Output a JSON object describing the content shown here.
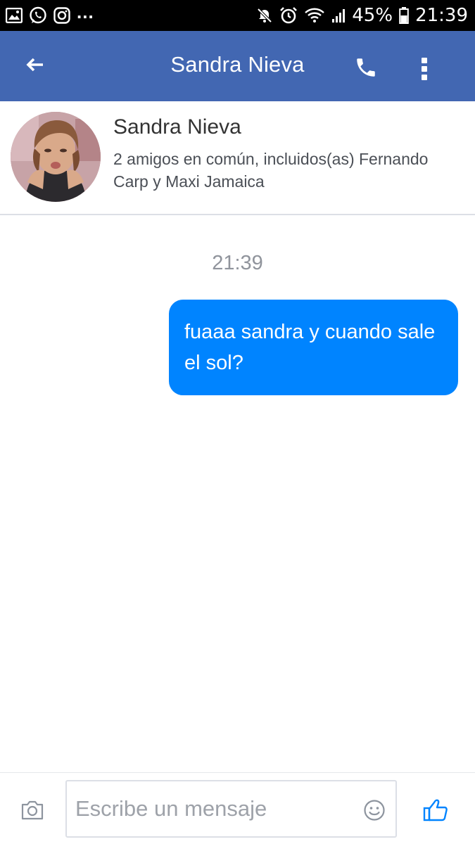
{
  "status_bar": {
    "left_icons": [
      "gallery-icon",
      "whatsapp-icon",
      "instagram-icon"
    ],
    "more_indicator": "...",
    "right_icons": [
      "mute-icon",
      "alarm-icon",
      "wifi-icon",
      "signal-icon",
      "battery-icon"
    ],
    "battery": "45%",
    "time": "21:39"
  },
  "header": {
    "title": "Sandra Nieva",
    "back_icon": "arrow-left-icon",
    "call_icon": "phone-icon",
    "menu_icon": "more-vertical-icon",
    "background": "#4267b2"
  },
  "profile": {
    "name": "Sandra Nieva",
    "mutual_friends": "2 amigos en común, incluidos(as) Fernando Carp y Maxi Jamaica"
  },
  "conversation": {
    "timestamp": "21:39",
    "messages": [
      {
        "sender": "me",
        "text": "fuaaa sandra y cuando sale el sol?",
        "bubble_color": "#0084ff"
      }
    ]
  },
  "composer": {
    "placeholder": "Escribe un mensaje",
    "value": "",
    "camera_icon": "camera-icon",
    "emoji_icon": "smiley-icon",
    "like_icon": "thumbs-up-icon"
  }
}
